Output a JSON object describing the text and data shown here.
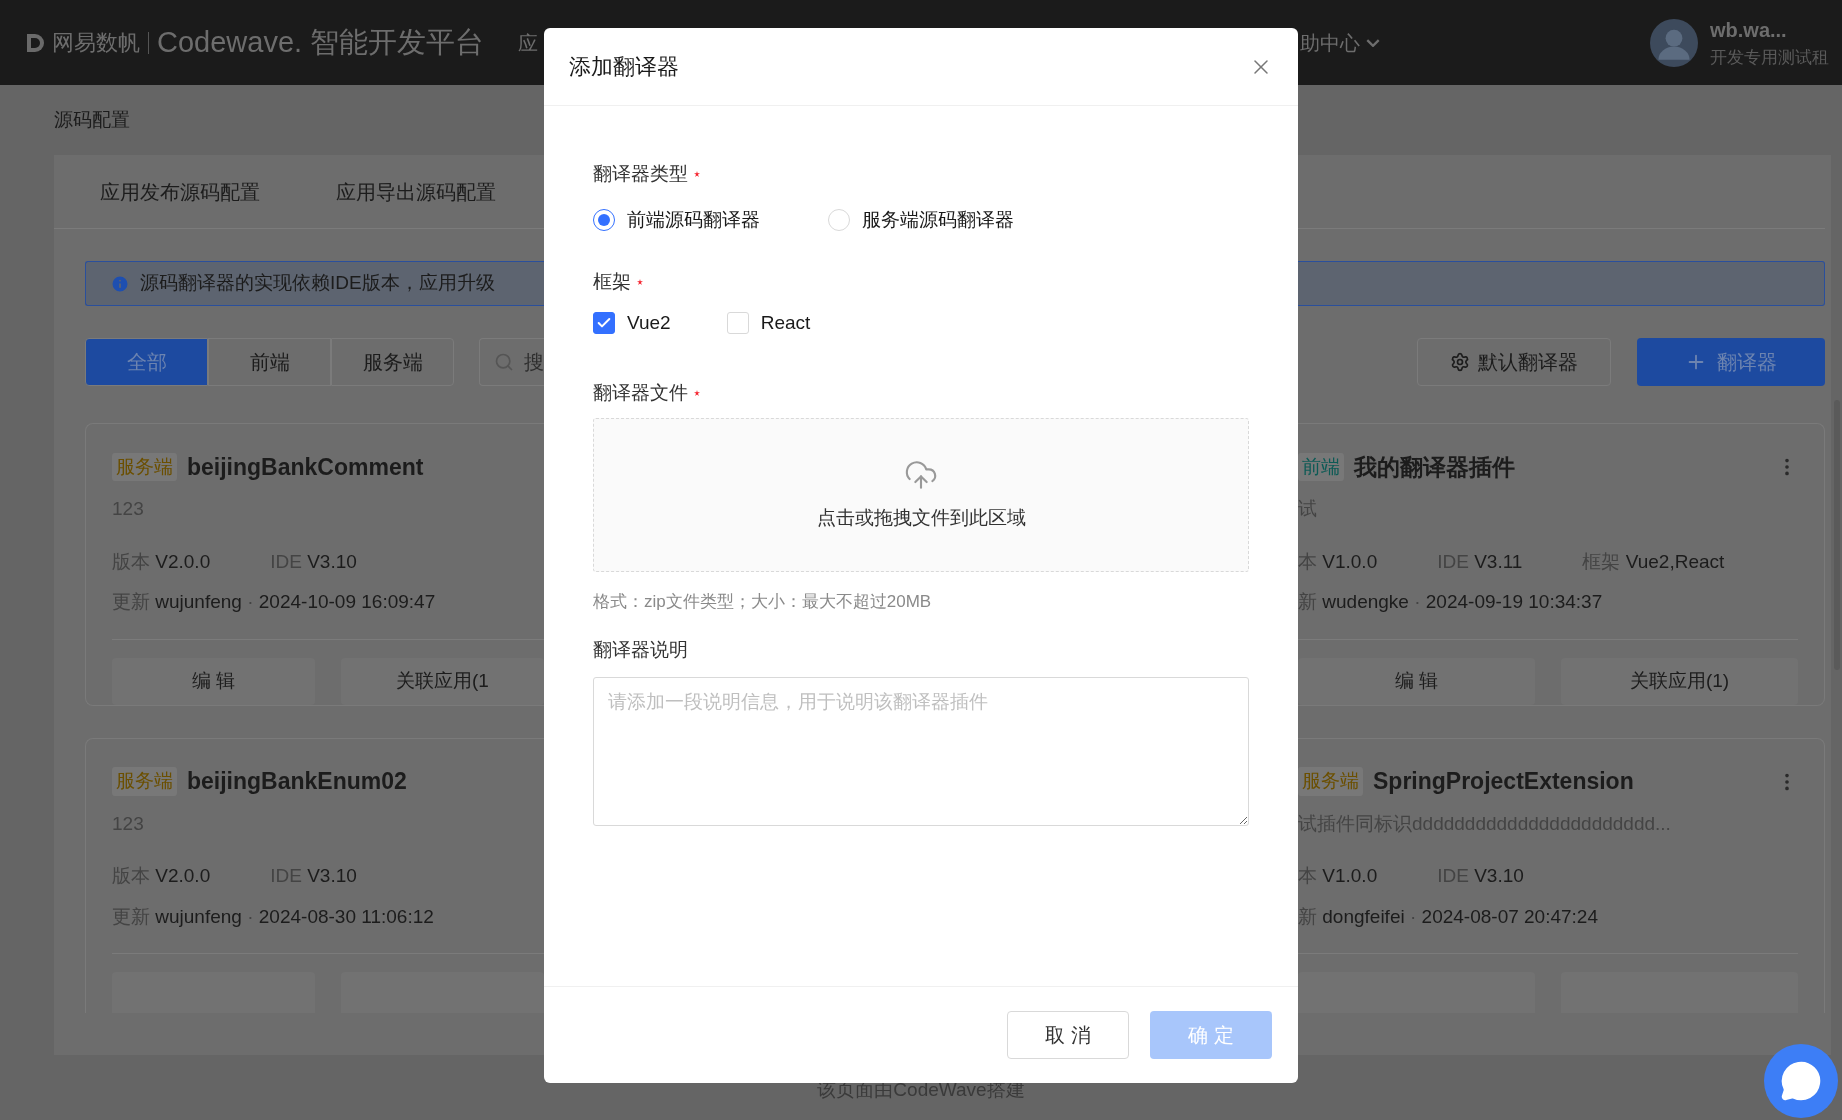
{
  "top_bar": {
    "brand": "网易数帆",
    "product": "Codewave.",
    "platform": "智能开发平台",
    "nav_fragment": "应",
    "help_menu": "助中心",
    "user_name": "wb.wa...",
    "tenant": "开发专用测试租"
  },
  "page": {
    "breadcrumb": "源码配置",
    "tabs": [
      "应用发布源码配置",
      "应用导出源码配置"
    ],
    "alert": "源码翻译器的实现依赖IDE版本，应用升级",
    "filters": [
      {
        "label": "全部",
        "selected": true
      },
      {
        "label": "前端",
        "selected": false
      },
      {
        "label": "服务端",
        "selected": false
      }
    ],
    "search": {
      "placeholder": "搜"
    },
    "default_button": "默认翻译器",
    "add_button": "翻译器",
    "left_cards": [
      {
        "tag": "服务端",
        "color": "#6b4f00",
        "title": "beijingBankComment",
        "description": "123",
        "meta": [
          {
            "label": "版本",
            "value": "V2.0.0"
          },
          {
            "label": "IDE",
            "value": "V3.10"
          }
        ],
        "update_label": "更新",
        "updater": "wujunfeng",
        "separator": "·",
        "updated": "2024-10-09 16:09:47",
        "actions": [
          "编 辑",
          "关联应用(1"
        ]
      },
      {
        "tag": "服务端",
        "color": "#6b4f00",
        "title": "beijingBankEnum02",
        "description": "123",
        "meta": [
          {
            "label": "版本",
            "value": "V2.0.0"
          },
          {
            "label": "IDE",
            "value": "V3.10"
          }
        ],
        "update_label": "更新",
        "updater": "wujunfeng",
        "separator": "·",
        "updated": "2024-08-30 11:06:12"
      }
    ],
    "right_cards": [
      {
        "tag": "前端",
        "color": "#0c5a55",
        "title": "我的翻译器插件",
        "description": "试",
        "meta": [
          {
            "label": "本",
            "value": "V1.0.0"
          },
          {
            "label": "IDE",
            "value": "V3.11"
          },
          {
            "label": "框架",
            "value": "Vue2,React"
          }
        ],
        "update_label": "新",
        "updater": "wudengke",
        "separator": "·",
        "updated": "2024-09-19 10:34:37",
        "actions": [
          "编 辑",
          "关联应用(1)"
        ]
      },
      {
        "tag": "服务端",
        "color": "#6b4f00",
        "title": "SpringProjectExtension",
        "description": "试插件同标识ddddddddddddddddddddddd...",
        "meta": [
          {
            "label": "本",
            "value": "V1.0.0"
          },
          {
            "label": "IDE",
            "value": "V3.10"
          }
        ],
        "update_label": "新",
        "updater": "dongfeifei",
        "separator": "·",
        "updated": "2024-08-07 20:47:24"
      }
    ],
    "footer": "该页面由CodeWave搭建"
  },
  "modal": {
    "title": "添加翻译器",
    "type_field": {
      "label": "翻译器类型",
      "required": true,
      "options": [
        {
          "label": "前端源码翻译器",
          "selected": true
        },
        {
          "label": "服务端源码翻译器",
          "selected": false
        }
      ]
    },
    "framework_field": {
      "label": "框架",
      "required": true,
      "options": [
        {
          "label": "Vue2",
          "checked": true
        },
        {
          "label": "React",
          "checked": false
        }
      ]
    },
    "file_field": {
      "label": "翻译器文件",
      "required": true,
      "drop_text": "点击或拖拽文件到此区域",
      "hint": "格式：zip文件类型；大小：最大不超过20MB"
    },
    "description_field": {
      "label": "翻译器说明",
      "placeholder": "请添加一段说明信息，用于说明该翻译器插件"
    },
    "buttons": [
      {
        "label": "取 消",
        "kind": "cancel",
        "disabled": false
      },
      {
        "label": "确 定",
        "kind": "primary",
        "disabled": true
      }
    ]
  }
}
